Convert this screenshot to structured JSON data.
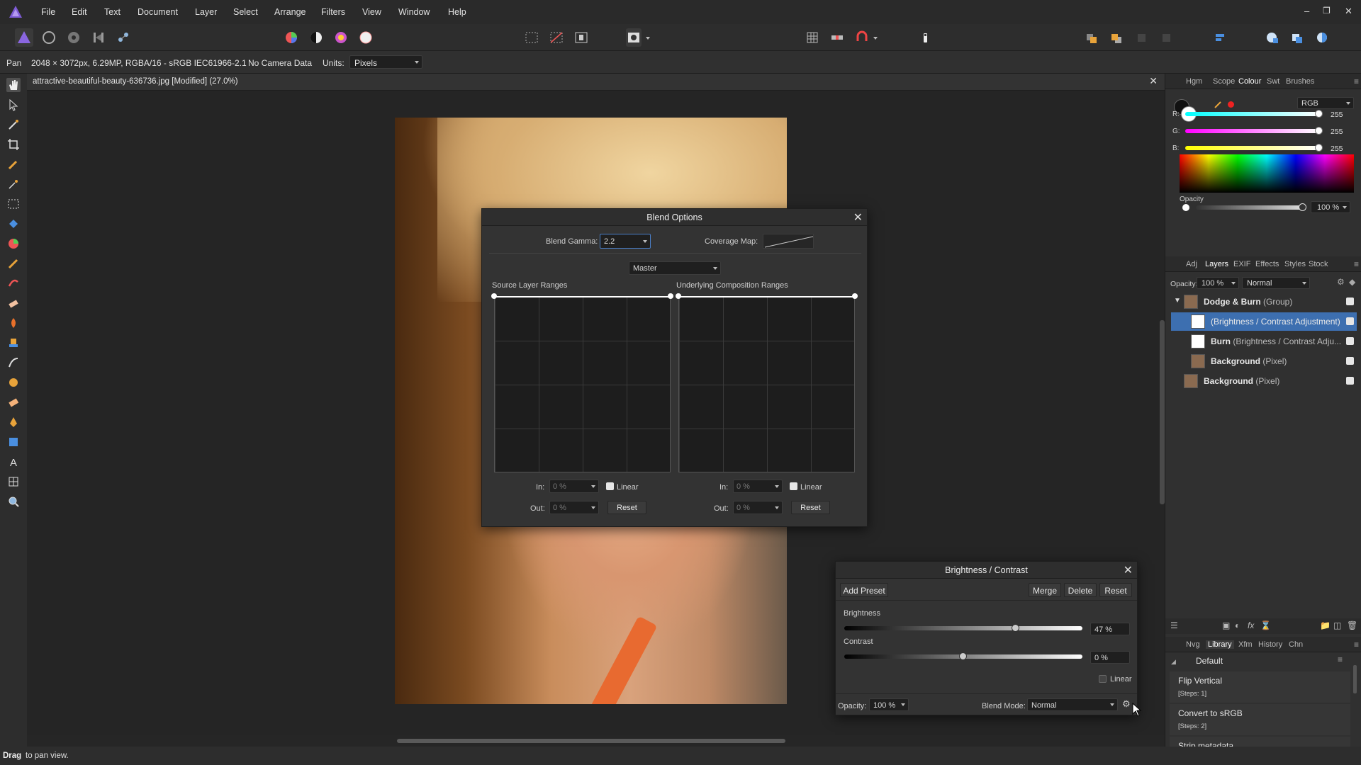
{
  "menubar": {
    "items": [
      "File",
      "Edit",
      "Text",
      "Document",
      "Layer",
      "Select",
      "Arrange",
      "Filters",
      "View",
      "Window",
      "Help"
    ]
  },
  "context_bar": {
    "tool_name": "Pan",
    "doc_info": "2048 × 3072px, 6.29MP, RGBA/16 - sRGB IEC61966-2.1",
    "camera": "No Camera Data",
    "units_label": "Units:",
    "units_value": "Pixels"
  },
  "document_tab": {
    "title": "attractive-beautiful-beauty-636736.jpg [Modified] (27.0%)"
  },
  "status": {
    "bold": "Drag",
    "rest": " to pan view."
  },
  "color_panel": {
    "tabs": [
      "Hgm",
      "Scope",
      "Colour",
      "Swt",
      "Brushes"
    ],
    "active_tab": "Colour",
    "mode": "RGB",
    "r_label": "R:",
    "r": "255",
    "g_label": "G:",
    "g": "255",
    "b_label": "B:",
    "b": "255",
    "opacity_label": "Opacity",
    "opacity": "100 %"
  },
  "layers_panel": {
    "tabs": [
      "Adj",
      "Layers",
      "EXIF",
      "Effects",
      "Styles",
      "Stock"
    ],
    "active_tab": "Layers",
    "opacity_label": "Opacity:",
    "opacity": "100 %",
    "blend": "Normal",
    "layers": [
      {
        "bold": "Dodge & Burn",
        "rest": " (Group)"
      },
      {
        "bold": "",
        "rest": "(Brightness / Contrast Adjustment)"
      },
      {
        "bold": "Burn",
        "rest": " (Brightness / Contrast Adju..."
      },
      {
        "bold": "Background",
        "rest": " (Pixel)"
      },
      {
        "bold": "Background",
        "rest": " (Pixel)"
      }
    ]
  },
  "history_panel": {
    "tabs": [
      "Nvg",
      "Library",
      "Xfm",
      "History",
      "Chn"
    ],
    "active_tab": "Library",
    "category": "Default",
    "items": [
      {
        "name": "Flip Vertical",
        "steps": "[Steps: 1]"
      },
      {
        "name": "Convert to sRGB",
        "steps": "[Steps: 2]"
      },
      {
        "name": "Strip metadata",
        "steps": ""
      }
    ]
  },
  "blend_options": {
    "title": "Blend Options",
    "gamma_label": "Blend Gamma:",
    "gamma_value": "2.2",
    "coverage_label": "Coverage Map:",
    "channel": "Master",
    "source_label": "Source Layer Ranges",
    "underlying_label": "Underlying Composition Ranges",
    "in_label": "In:",
    "out_label": "Out:",
    "in_value": "0 %",
    "out_value": "0 %",
    "linear_label": "Linear",
    "reset_label": "Reset"
  },
  "bc_dialog": {
    "title": "Brightness / Contrast",
    "add_preset": "Add Preset",
    "merge": "Merge",
    "delete": "Delete",
    "reset": "Reset",
    "brightness_label": "Brightness",
    "brightness_value": "47 %",
    "brightness_level": 0.72,
    "contrast_label": "Contrast",
    "contrast_value": "0 %",
    "contrast_level": 0.5,
    "linear_label": "Linear",
    "opacity_label": "Opacity:",
    "opacity_value": "100 %",
    "blend_mode_label": "Blend Mode:",
    "blend_mode_value": "Normal"
  },
  "colors": {
    "accent": "#4a7fc7",
    "selected_row": "#3d6fb0"
  }
}
